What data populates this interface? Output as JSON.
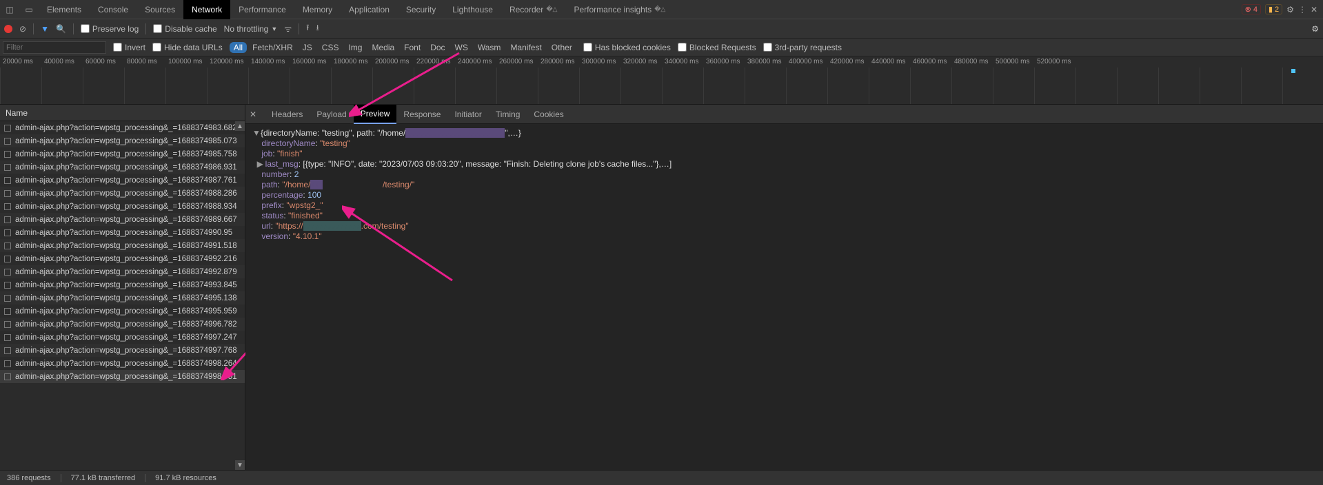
{
  "topbar": {
    "tabs": [
      "Elements",
      "Console",
      "Sources",
      "Network",
      "Performance",
      "Memory",
      "Application",
      "Security",
      "Lighthouse",
      "Recorder",
      "Performance insights"
    ],
    "active": "Network",
    "errors": 4,
    "warnings": 2
  },
  "toolbar": {
    "preserve_log": "Preserve log",
    "disable_cache": "Disable cache",
    "throttling": "No throttling"
  },
  "filterbar": {
    "filter_placeholder": "Filter",
    "invert": "Invert",
    "hide_data_urls": "Hide data URLs",
    "types": [
      "All",
      "Fetch/XHR",
      "JS",
      "CSS",
      "Img",
      "Media",
      "Font",
      "Doc",
      "WS",
      "Wasm",
      "Manifest",
      "Other"
    ],
    "type_active": "All",
    "has_blocked": "Has blocked cookies",
    "blocked_req": "Blocked Requests",
    "third_party": "3rd-party requests"
  },
  "timeline": {
    "ticks": [
      "20000 ms",
      "40000 ms",
      "60000 ms",
      "80000 ms",
      "100000 ms",
      "120000 ms",
      "140000 ms",
      "160000 ms",
      "180000 ms",
      "200000 ms",
      "220000 ms",
      "240000 ms",
      "260000 ms",
      "280000 ms",
      "300000 ms",
      "320000 ms",
      "340000 ms",
      "360000 ms",
      "380000 ms",
      "400000 ms",
      "420000 ms",
      "440000 ms",
      "460000 ms",
      "480000 ms",
      "500000 ms",
      "520000 ms"
    ]
  },
  "requests": {
    "header": "Name",
    "rows": [
      "admin-ajax.php?action=wpstg_processing&_=1688374983.682",
      "admin-ajax.php?action=wpstg_processing&_=1688374985.073",
      "admin-ajax.php?action=wpstg_processing&_=1688374985.758",
      "admin-ajax.php?action=wpstg_processing&_=1688374986.931",
      "admin-ajax.php?action=wpstg_processing&_=1688374987.761",
      "admin-ajax.php?action=wpstg_processing&_=1688374988.286",
      "admin-ajax.php?action=wpstg_processing&_=1688374988.934",
      "admin-ajax.php?action=wpstg_processing&_=1688374989.667",
      "admin-ajax.php?action=wpstg_processing&_=1688374990.95",
      "admin-ajax.php?action=wpstg_processing&_=1688374991.518",
      "admin-ajax.php?action=wpstg_processing&_=1688374992.216",
      "admin-ajax.php?action=wpstg_processing&_=1688374992.879",
      "admin-ajax.php?action=wpstg_processing&_=1688374993.845",
      "admin-ajax.php?action=wpstg_processing&_=1688374995.138",
      "admin-ajax.php?action=wpstg_processing&_=1688374995.959",
      "admin-ajax.php?action=wpstg_processing&_=1688374996.782",
      "admin-ajax.php?action=wpstg_processing&_=1688374997.247",
      "admin-ajax.php?action=wpstg_processing&_=1688374997.768",
      "admin-ajax.php?action=wpstg_processing&_=1688374998.264",
      "admin-ajax.php?action=wpstg_processing&_=1688374998.751"
    ],
    "selected": 19
  },
  "detail": {
    "tabs": [
      "Headers",
      "Payload",
      "Preview",
      "Response",
      "Initiator",
      "Timing",
      "Cookies"
    ],
    "active": "Preview",
    "preview": {
      "root_summary": "{directoryName: \"testing\", path: \"/home/",
      "root_tail": "\",…}",
      "directoryName_key": "directoryName",
      "directoryName_val": "\"testing\"",
      "job_key": "job",
      "job_val": "\"finish\"",
      "last_msg_key": "last_msg",
      "last_msg_val": "[{type: \"INFO\", date: \"2023/07/03 09:03:20\", message: \"Finish: Deleting clone job's cache files...\"},…]",
      "number_key": "number",
      "number_val": "2",
      "path_key": "path",
      "path_val_pre": "\"/home/",
      "path_val_post": "/testing/\"",
      "percentage_key": "percentage",
      "percentage_val": "100",
      "prefix_key": "prefix",
      "prefix_val": "\"wpstg2_\"",
      "status_key": "status",
      "status_val": "\"finished\"",
      "url_key": "url",
      "url_val_pre": "\"https://",
      "url_val_post": ".com/testing\"",
      "version_key": "version",
      "version_val": "\"4.10.1\""
    }
  },
  "status": {
    "requests": "386 requests",
    "transferred": "77.1 kB transferred",
    "resources": "91.7 kB resources"
  }
}
